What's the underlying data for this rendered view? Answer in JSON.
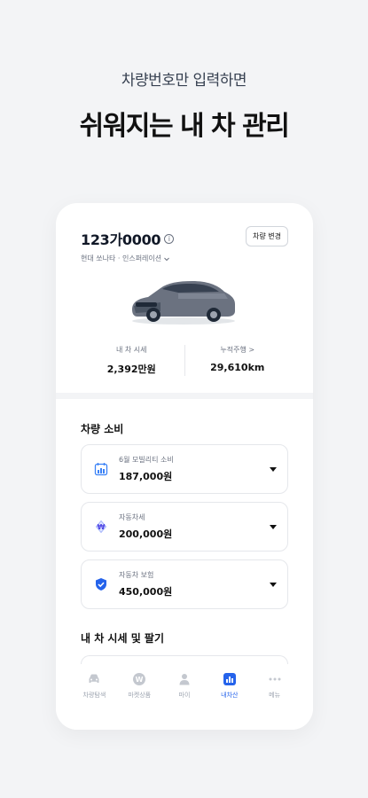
{
  "promo": {
    "subtitle": "차량번호만 입력하면",
    "title": "쉬워지는 내 차 관리"
  },
  "car": {
    "plate": "123가0000",
    "model": "현대 쏘나타 · 인스퍼레이션",
    "change_button": "차량 변경"
  },
  "stats": [
    {
      "label": "내 차 시세",
      "value": "2,392만원"
    },
    {
      "label": "누적주행 >",
      "value": "29,610km"
    }
  ],
  "consumption": {
    "title": "차량 소비",
    "items": [
      {
        "label": "6월 모빌리티 소비",
        "value": "187,000원",
        "icon": "calendar-chart-icon",
        "color": "#3b82f6"
      },
      {
        "label": "자동차세",
        "value": "200,000원",
        "icon": "tax-icon",
        "color": "#6366f1"
      },
      {
        "label": "자동차 보험",
        "value": "450,000원",
        "icon": "shield-check-icon",
        "color": "#2563eb"
      }
    ]
  },
  "market": {
    "title": "내 차 시세 및 팔기"
  },
  "tabs": [
    {
      "label": "차량탐색",
      "icon": "car-icon",
      "active": false
    },
    {
      "label": "마켓상품",
      "icon": "w-coin-icon",
      "active": false
    },
    {
      "label": "마이",
      "icon": "person-icon",
      "active": false
    },
    {
      "label": "내차산",
      "icon": "bar-chart-icon",
      "active": true
    },
    {
      "label": "메뉴",
      "icon": "more-dots-icon",
      "active": false
    }
  ],
  "colors": {
    "accent": "#2563eb",
    "background": "#f3f4f6",
    "card": "#ffffff"
  }
}
